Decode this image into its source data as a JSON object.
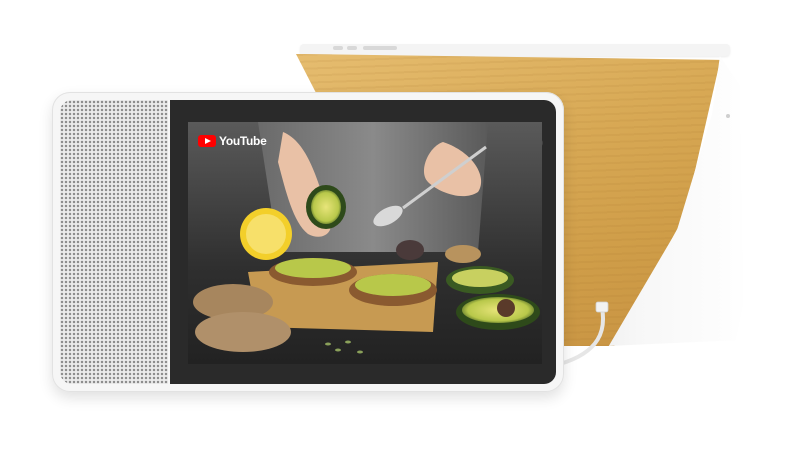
{
  "screen": {
    "brand_text": "YouTube",
    "brand_icon": "youtube-play-icon"
  },
  "colors": {
    "bamboo": "#d8a955",
    "device_body": "#f6f6f6",
    "bezel": "#2a2a2a",
    "youtube_red": "#ff0000"
  }
}
